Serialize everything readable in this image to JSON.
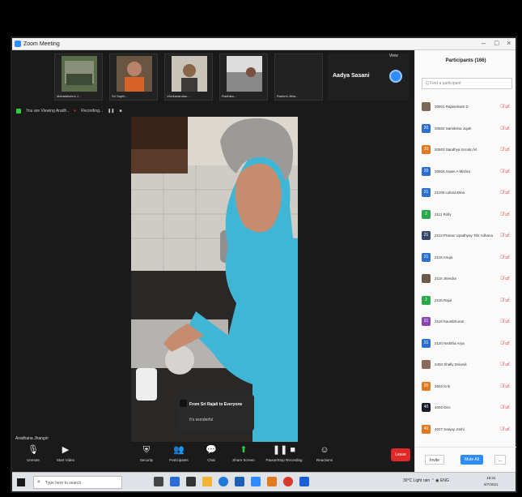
{
  "window": {
    "title": "Zoom Meeting"
  },
  "thumbnails": [
    {
      "name": "Mahalakshmi J..."
    },
    {
      "name": "Sri Sapth..."
    },
    {
      "name": "Vivekanandan..."
    },
    {
      "name": "Radhika..."
    },
    {
      "name": "Rashmi Jitha..."
    }
  ],
  "active_speaker": {
    "name": "Aadya Sasani"
  },
  "view_label": "View",
  "info_bar": {
    "share_label": "You are Viewing Aradh..",
    "recording_label": "Recording..."
  },
  "chat_popup": {
    "header": "From Sri Rajali to Everyone",
    "message": "It's wonderful"
  },
  "self_name": "Aradhana Jhangiri",
  "toolbar": [
    {
      "label": "Unmute",
      "icon": "microphone-muted-icon"
    },
    {
      "label": "Start Video",
      "icon": "video-off-icon"
    },
    {
      "label": "Security",
      "icon": "shield-icon"
    },
    {
      "label": "Participants",
      "icon": "participants-icon",
      "count": "166"
    },
    {
      "label": "Chat",
      "icon": "chat-icon"
    },
    {
      "label": "Share Screen",
      "icon": "share-screen-icon"
    },
    {
      "label": "Pause/Stop Recording",
      "icon": "record-icon"
    },
    {
      "label": "Reactions",
      "icon": "reactions-icon"
    }
  ],
  "end_button": "Leave",
  "participants_panel": {
    "title": "Participants (166)",
    "search_placeholder": "Q Find a participant",
    "items": [
      {
        "name": "20501 Rajaselvam D",
        "initial": "",
        "color": "#7a6a55"
      },
      {
        "name": "20502 Samiksha Jojah",
        "initial": "20",
        "color": "#2d6fd1"
      },
      {
        "name": "20503 Sandhya Scrutin M",
        "initial": "20",
        "color": "#e0791f"
      },
      {
        "name": "20504 Aswin A Mishra",
        "initial": "20",
        "color": "#2d6fd1"
      },
      {
        "name": "21106 Lulusa Bina",
        "initial": "21",
        "color": "#2d6fd1"
      },
      {
        "name": "2111 Rolly",
        "initial": "2",
        "color": "#2aa84a"
      },
      {
        "name": "2113 Pranav Upadhyay Tibr Adhanan",
        "initial": "21",
        "color": "#35496b"
      },
      {
        "name": "2115 Anuja",
        "initial": "21",
        "color": "#2d6fd1"
      },
      {
        "name": "2116 Jitendra",
        "initial": "",
        "color": "#6b5a45"
      },
      {
        "name": "2118 Rajul",
        "initial": "2",
        "color": "#2aa84a"
      },
      {
        "name": "2119 Kaustbhunar",
        "initial": "21",
        "color": "#8a45b0"
      },
      {
        "name": "2120 Nishtha Arya",
        "initial": "21",
        "color": "#2d6fd1"
      },
      {
        "name": "2403 Shally Dvivedi",
        "initial": "",
        "color": "#8a6a5a"
      },
      {
        "name": "2502 Kriti",
        "initial": "25",
        "color": "#e0791f"
      },
      {
        "name": "4002 Diro",
        "initial": "40",
        "color": "#1b1b2e"
      },
      {
        "name": "4027 Sanjay Joshi",
        "initial": "40",
        "color": "#e0791f"
      }
    ],
    "invite_label": "Invite",
    "mute_all_label": "Mute All",
    "more_label": "..."
  },
  "taskbar": {
    "search_placeholder": "Type here to search",
    "weather": "30°C Light rain",
    "language": "ENG",
    "time": "15:31",
    "date": "6/7/2021"
  }
}
